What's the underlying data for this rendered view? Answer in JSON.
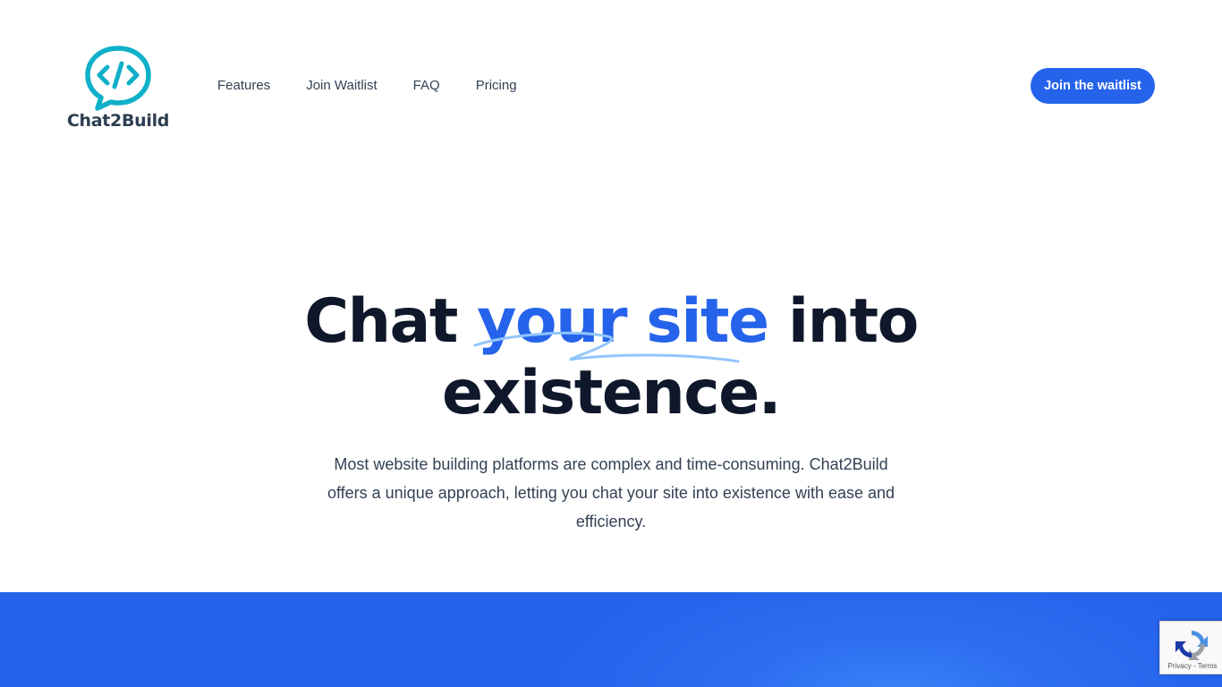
{
  "brand": {
    "name": "Chat2Build",
    "logo_color": "#0fb0c9"
  },
  "nav": {
    "items": [
      {
        "label": "Features"
      },
      {
        "label": "Join Waitlist"
      },
      {
        "label": "FAQ"
      },
      {
        "label": "Pricing"
      }
    ]
  },
  "header": {
    "cta_label": "Join the waitlist"
  },
  "hero": {
    "title_before": "Chat ",
    "title_highlight": "your site",
    "title_after": " into existence.",
    "subtitle": "Most website building platforms are complex and time-consuming. Chat2Build offers a unique approach, letting you chat your site into existence with ease and efficiency."
  },
  "recaptcha": {
    "privacy": "Privacy",
    "separator": " - ",
    "terms": "Terms"
  },
  "colors": {
    "accent": "#2563eb",
    "heading": "#0f172a",
    "body_text": "#334155"
  }
}
